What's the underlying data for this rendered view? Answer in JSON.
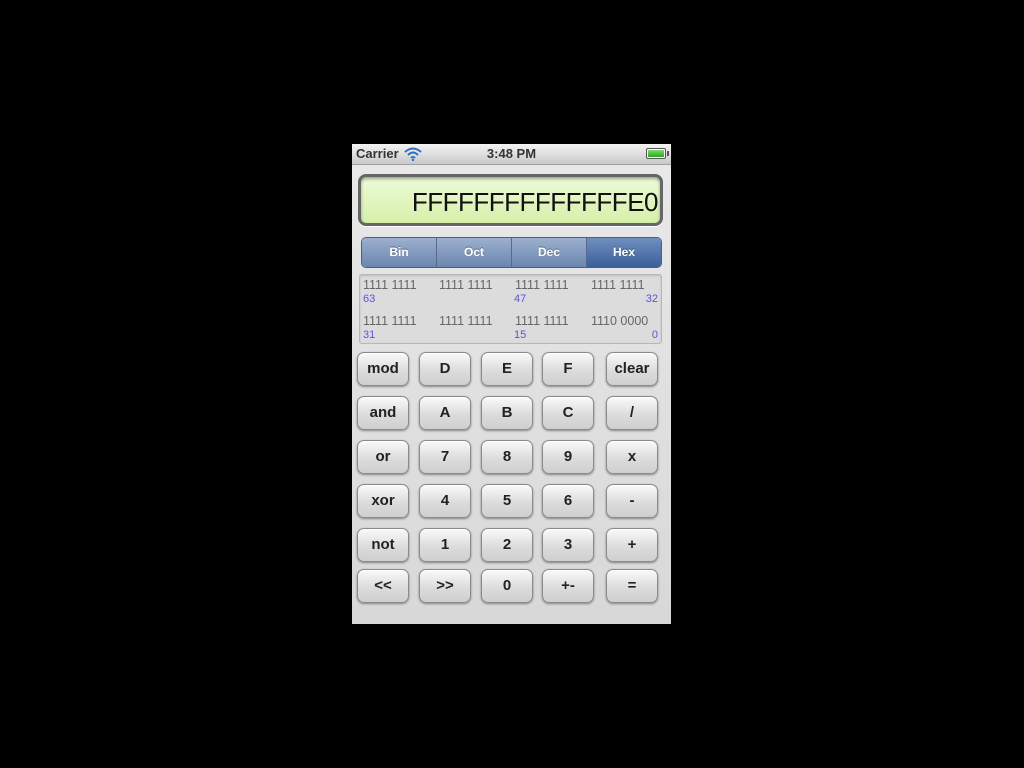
{
  "status_bar": {
    "carrier": "Carrier",
    "time": "3:48 PM",
    "wifi_icon": "wifi-icon",
    "battery_icon": "battery-icon"
  },
  "display": {
    "value": "FFFFFFFFFFFFFFE0"
  },
  "base_selector": {
    "options": [
      "Bin",
      "Oct",
      "Dec",
      "Hex"
    ],
    "selected": "Hex"
  },
  "bit_view": {
    "upper": {
      "groups": [
        "1111 1111",
        "1111 1111",
        "1111 1111",
        "1111 1111"
      ],
      "index_left": "63",
      "index_mid": "47",
      "index_right": "32"
    },
    "lower": {
      "groups": [
        "1111 1111",
        "1111 1111",
        "1111 1111",
        "1110 0000"
      ],
      "index_left": "31",
      "index_mid": "15",
      "index_right": "0"
    }
  },
  "keypad": {
    "rows": [
      [
        "mod",
        "D",
        "E",
        "F",
        "clear"
      ],
      [
        "and",
        "A",
        "B",
        "C",
        "/"
      ],
      [
        "or",
        "7",
        "8",
        "9",
        "x"
      ],
      [
        "xor",
        "4",
        "5",
        "6",
        "-"
      ],
      [
        "not",
        "1",
        "2",
        "3",
        "+"
      ],
      [
        "<<",
        ">>",
        "0",
        "+-",
        "="
      ]
    ]
  },
  "colors": {
    "display_bg": "#e6f7c4",
    "segment_selected": "#3b5f99",
    "bit_index": "#5555dd"
  }
}
